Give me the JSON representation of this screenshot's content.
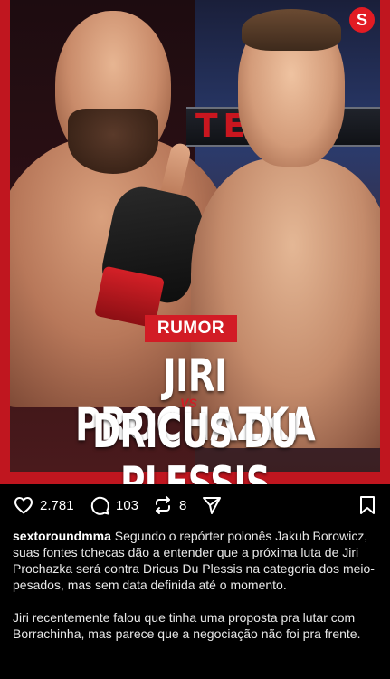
{
  "post": {
    "image": {
      "badge": "RUMOR",
      "headline_line1": "JIRI PROCHAZKA",
      "vs": "VS",
      "headline_line2": "DRICUS DU PLESSIS",
      "logo_glyph": "S",
      "banner": "TE   AU",
      "brand_color": "#d21c25"
    },
    "actions": {
      "likes": "2.781",
      "comments": "103",
      "reposts": "8"
    },
    "caption": {
      "username": "sextoroundmma",
      "text1": " Segundo o repórter polonês Jakub Borowicz, suas fontes tchecas dão a entender que a próxima luta de Jiri Prochazka será contra Dricus Du Plessis na categoria dos meio-pesados, mas sem data definida até o momento.",
      "text2": "Jiri recentemente falou que tinha uma proposta pra lutar com Borrachinha, mas parece que a negociação não foi pra frente."
    }
  }
}
